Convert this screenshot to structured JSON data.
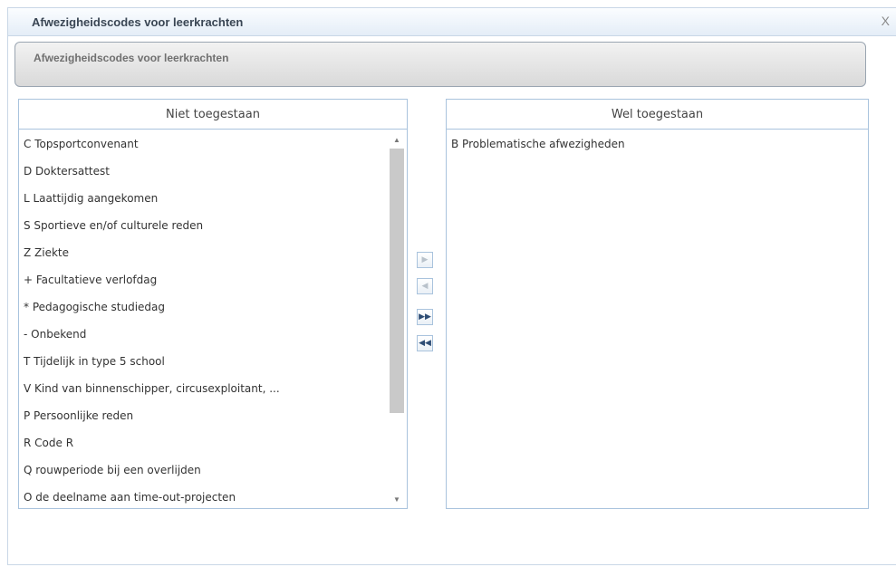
{
  "window": {
    "title": "Afwezigheidscodes voor leerkrachten",
    "close_label": "X"
  },
  "header": {
    "text": "Afwezigheidscodes voor leerkrachten"
  },
  "left_list": {
    "header": "Niet toegestaan",
    "items": [
      "C Topsportconvenant",
      "D Doktersattest",
      "L Laattijdig aangekomen",
      "S Sportieve en/of culturele reden",
      "Z Ziekte",
      "+ Facultatieve verlofdag",
      "* Pedagogische studiedag",
      "- Onbekend",
      "T Tijdelijk in type 5 school",
      "V Kind van binnenschipper, circusexploitant, ...",
      "P Persoonlijke reden",
      "R Code R",
      "Q rouwperiode bij een overlijden",
      "O de deelname aan time-out-projecten"
    ]
  },
  "right_list": {
    "header": "Wel toegestaan",
    "items": [
      "B Problematische afwezigheden"
    ]
  },
  "transfer_buttons": {
    "move_right": "▶",
    "move_left": "◀",
    "move_all_right": "▶▶",
    "move_all_left": "◀◀"
  },
  "scrollbar": {
    "up": "▲",
    "down": "▼"
  }
}
